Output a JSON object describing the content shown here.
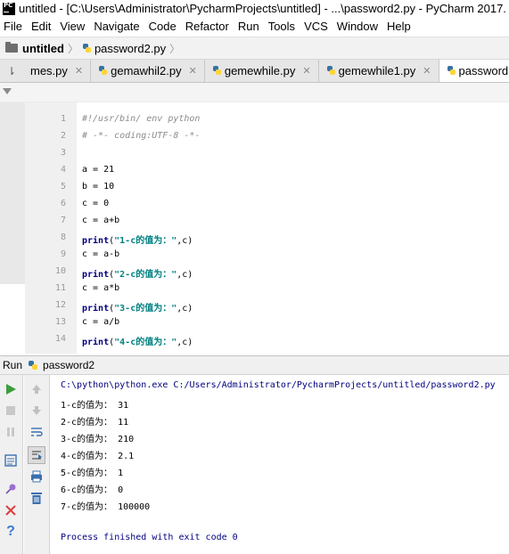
{
  "window": {
    "title": "untitled - [C:\\Users\\Administrator\\PycharmProjects\\untitled] - ...\\password2.py - PyCharm 2017."
  },
  "menu": [
    "File",
    "Edit",
    "View",
    "Navigate",
    "Code",
    "Refactor",
    "Run",
    "Tools",
    "VCS",
    "Window",
    "Help"
  ],
  "breadcrumb": {
    "project": "untitled",
    "file": "password2.py"
  },
  "tabs": [
    {
      "label": "mes.py"
    },
    {
      "label": "gemawhil2.py"
    },
    {
      "label": "gemewhile.py"
    },
    {
      "label": "gemewhile1.py"
    },
    {
      "label": "password"
    }
  ],
  "editor": {
    "line_numbers": [
      "1",
      "2",
      "3",
      "4",
      "5",
      "6",
      "7",
      "8",
      "9",
      "10",
      "11",
      "12",
      "13",
      "14"
    ],
    "lines": [
      {
        "text": "#!/usr/bin/ env python",
        "kind": "comment"
      },
      {
        "text": "# -*- coding:UTF-8 -*-",
        "kind": "comment"
      },
      {
        "text": "",
        "kind": "plain"
      },
      {
        "text": "a = 21",
        "kind": "plain"
      },
      {
        "text": "b = 10",
        "kind": "plain"
      },
      {
        "text": "c = 0",
        "kind": "plain"
      },
      {
        "text": "c = a+b",
        "kind": "plain"
      },
      {
        "kind": "print",
        "kw": "print",
        "open": "(",
        "str": "\"1-c的值为：\"",
        "rest": ",c)"
      },
      {
        "text": "c = a-b",
        "kind": "plain"
      },
      {
        "kind": "print",
        "kw": "print",
        "open": "(",
        "str": "\"2-c的值为：\"",
        "rest": ",c)"
      },
      {
        "text": "c = a*b",
        "kind": "plain"
      },
      {
        "kind": "print",
        "kw": "print",
        "open": "(",
        "str": "\"3-c的值为：\"",
        "rest": ",c)"
      },
      {
        "text": "c = a/b",
        "kind": "plain"
      },
      {
        "kind": "print",
        "kw": "print",
        "open": "(",
        "str": "\"4-c的值为：\"",
        "rest": ",c)"
      }
    ]
  },
  "run_panel": {
    "label": "Run",
    "config_name": "password2",
    "console": [
      {
        "text": "C:\\python\\python.exe C:/Users/Administrator/PycharmProjects/untitled/password2.py",
        "kind": "cmd"
      },
      {
        "text": "1-c的值为： 31",
        "kind": "out"
      },
      {
        "text": "2-c的值为： 11",
        "kind": "out"
      },
      {
        "text": "3-c的值为： 210",
        "kind": "out"
      },
      {
        "text": "4-c的值为： 2.1",
        "kind": "out"
      },
      {
        "text": "5-c的值为： 1",
        "kind": "out"
      },
      {
        "text": "6-c的值为： 0",
        "kind": "out"
      },
      {
        "text": "7-c的值为： 100000",
        "kind": "out"
      },
      {
        "text": "",
        "kind": "out"
      },
      {
        "text": "Process finished with exit code 0",
        "kind": "exit"
      }
    ]
  },
  "colors": {
    "keyword": "#000080",
    "string": "#008080",
    "comment": "#8c8c8c",
    "run_green": "#3c9d3c",
    "stop_red": "#d94040"
  }
}
